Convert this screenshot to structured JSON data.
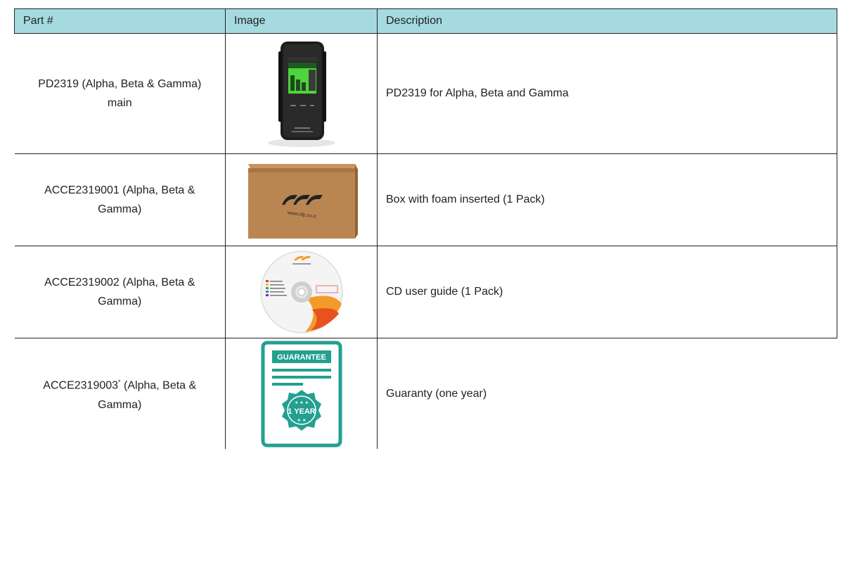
{
  "table": {
    "headers": [
      "Part #",
      "Image",
      "Description"
    ],
    "header_color": "#a5dbe0",
    "rows": [
      {
        "part": "PD2319 (Alpha, Beta & Gamma) main",
        "image": "handheld-detector-device",
        "description": "PD2319 for Alpha, Beta and Gamma"
      },
      {
        "part": "ACCE2319001 (Alpha, Beta & Gamma)",
        "image": "cardboard-box",
        "box_logo_text": "www.cfp.co.ir",
        "description": "Box with foam inserted (1 Pack)"
      },
      {
        "part": "ACCE2319002 (Alpha, Beta & Gamma)",
        "image": "cd-disc",
        "description": "CD user guide (1 Pack)"
      },
      {
        "part_prefix": "ACCE2319003",
        "part_sup": "*",
        "part_suffix": " (Alpha, Beta & Gamma)",
        "image": "guarantee-certificate",
        "guarantee_title": "GUARANTEE",
        "guarantee_badge": "1 YEAR",
        "description": "Guaranty (one year)"
      }
    ]
  }
}
